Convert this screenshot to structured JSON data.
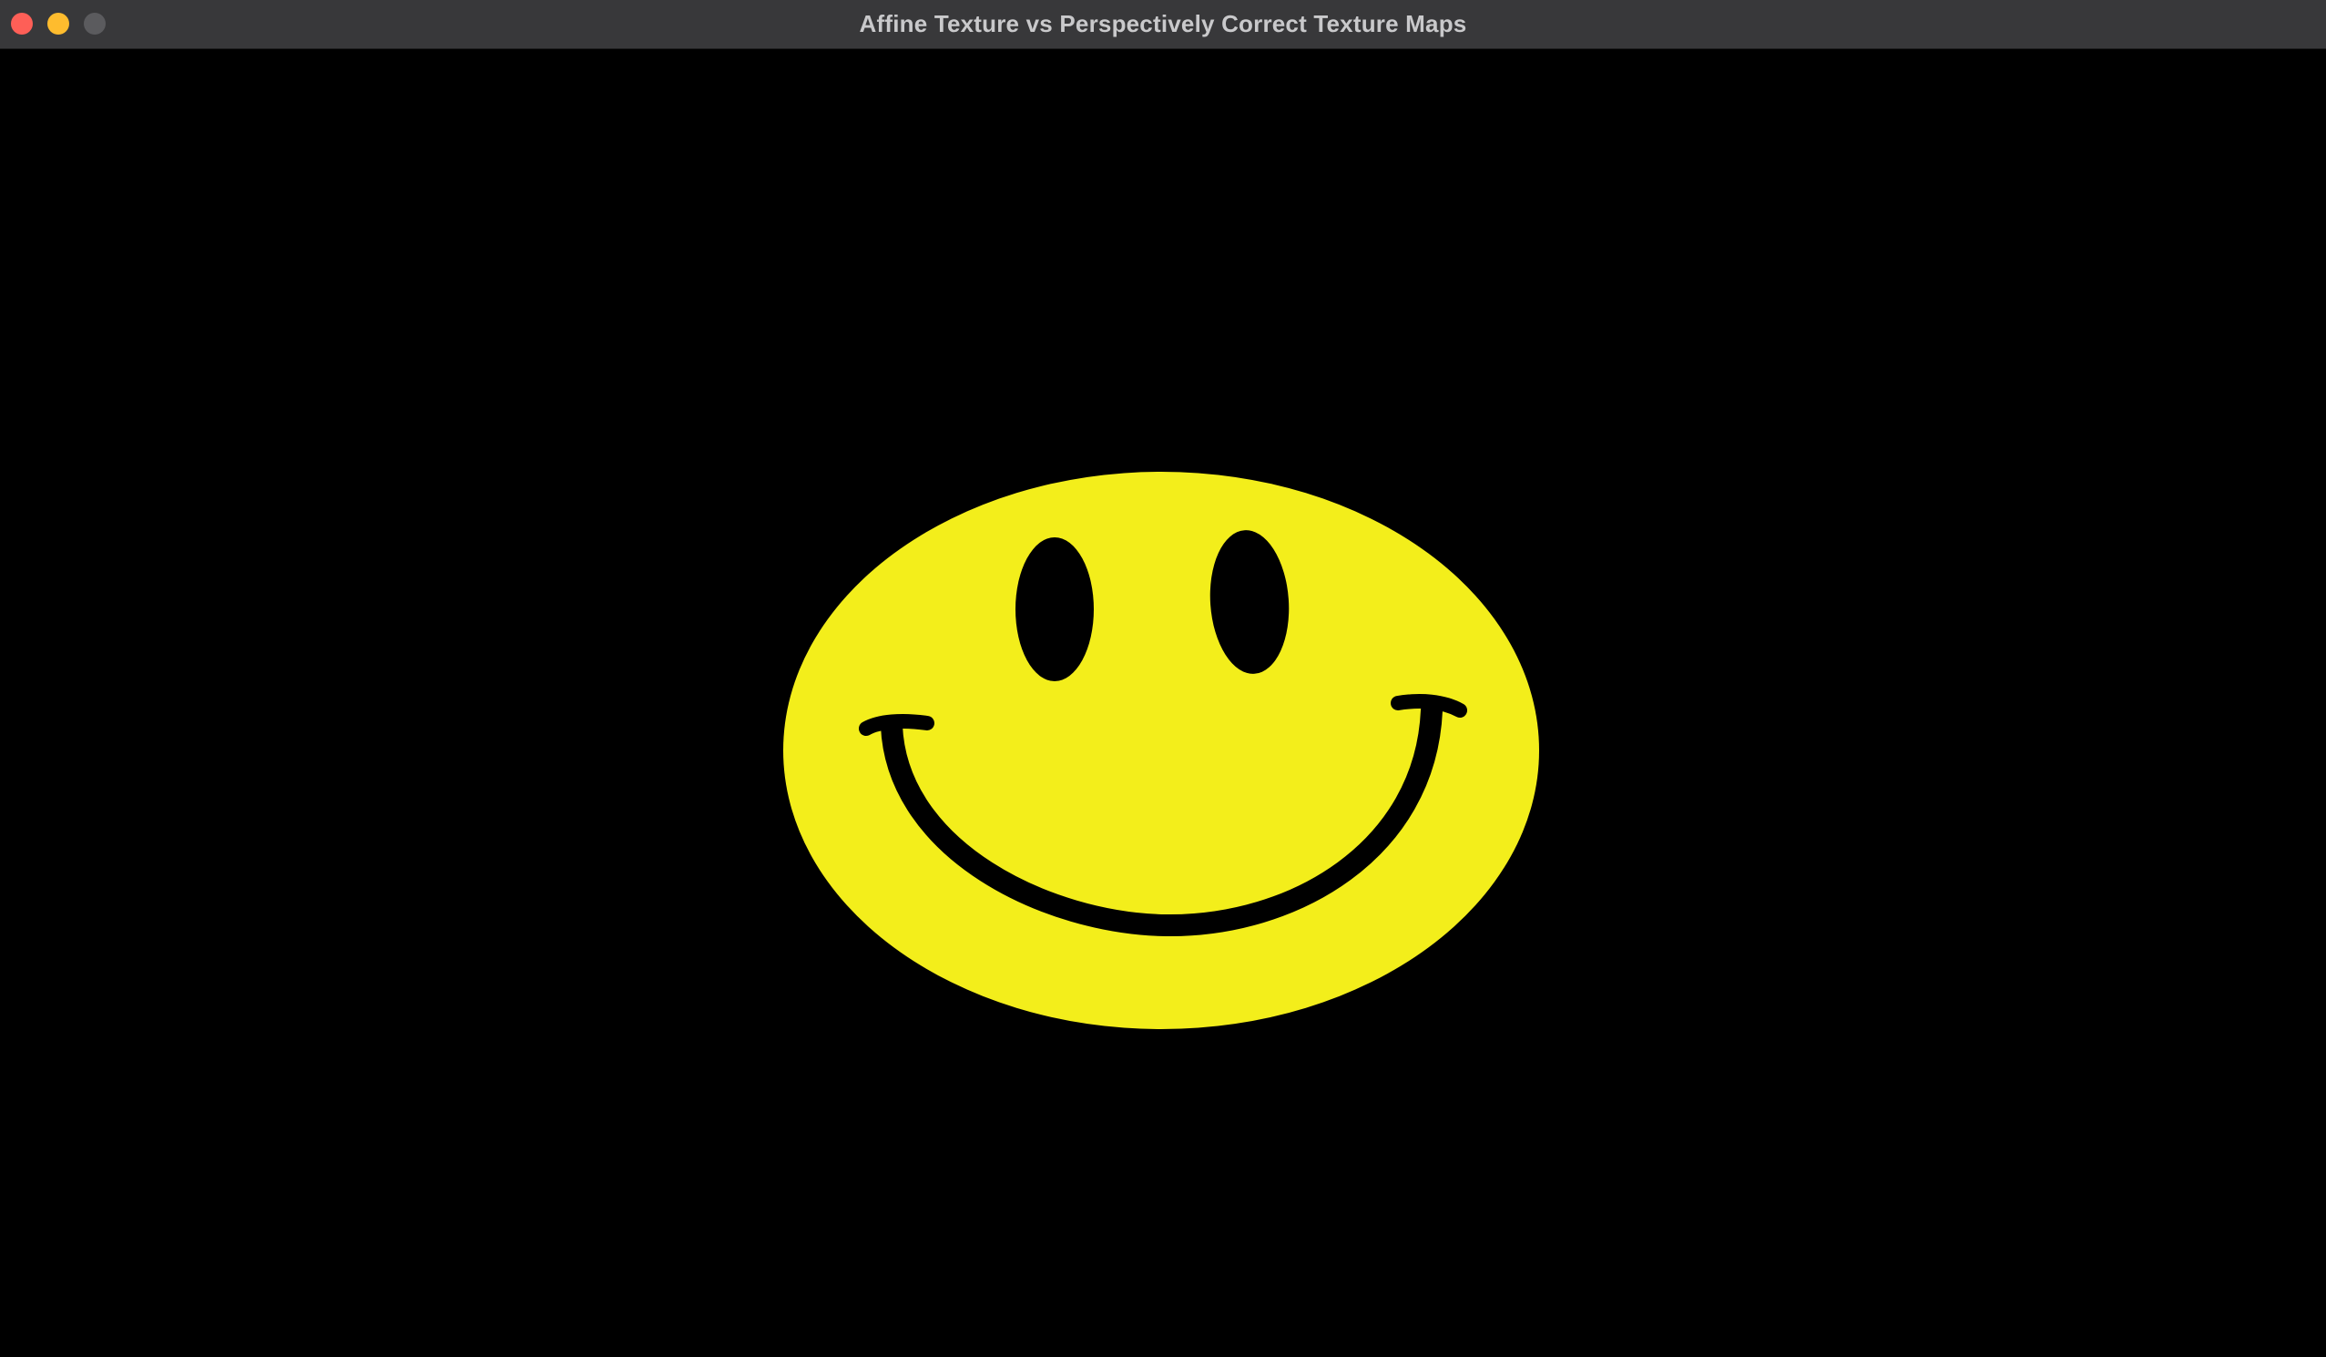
{
  "window": {
    "title": "Affine Texture vs Perspectively Correct Texture Maps",
    "controls": {
      "close": "close-button",
      "minimize": "minimize-button",
      "zoom": "zoom-button"
    }
  },
  "scene": {
    "background_color": "#000000",
    "face_color": "#f3ee1b",
    "feature_color": "#000000",
    "subject": "smiley-face-texture"
  }
}
